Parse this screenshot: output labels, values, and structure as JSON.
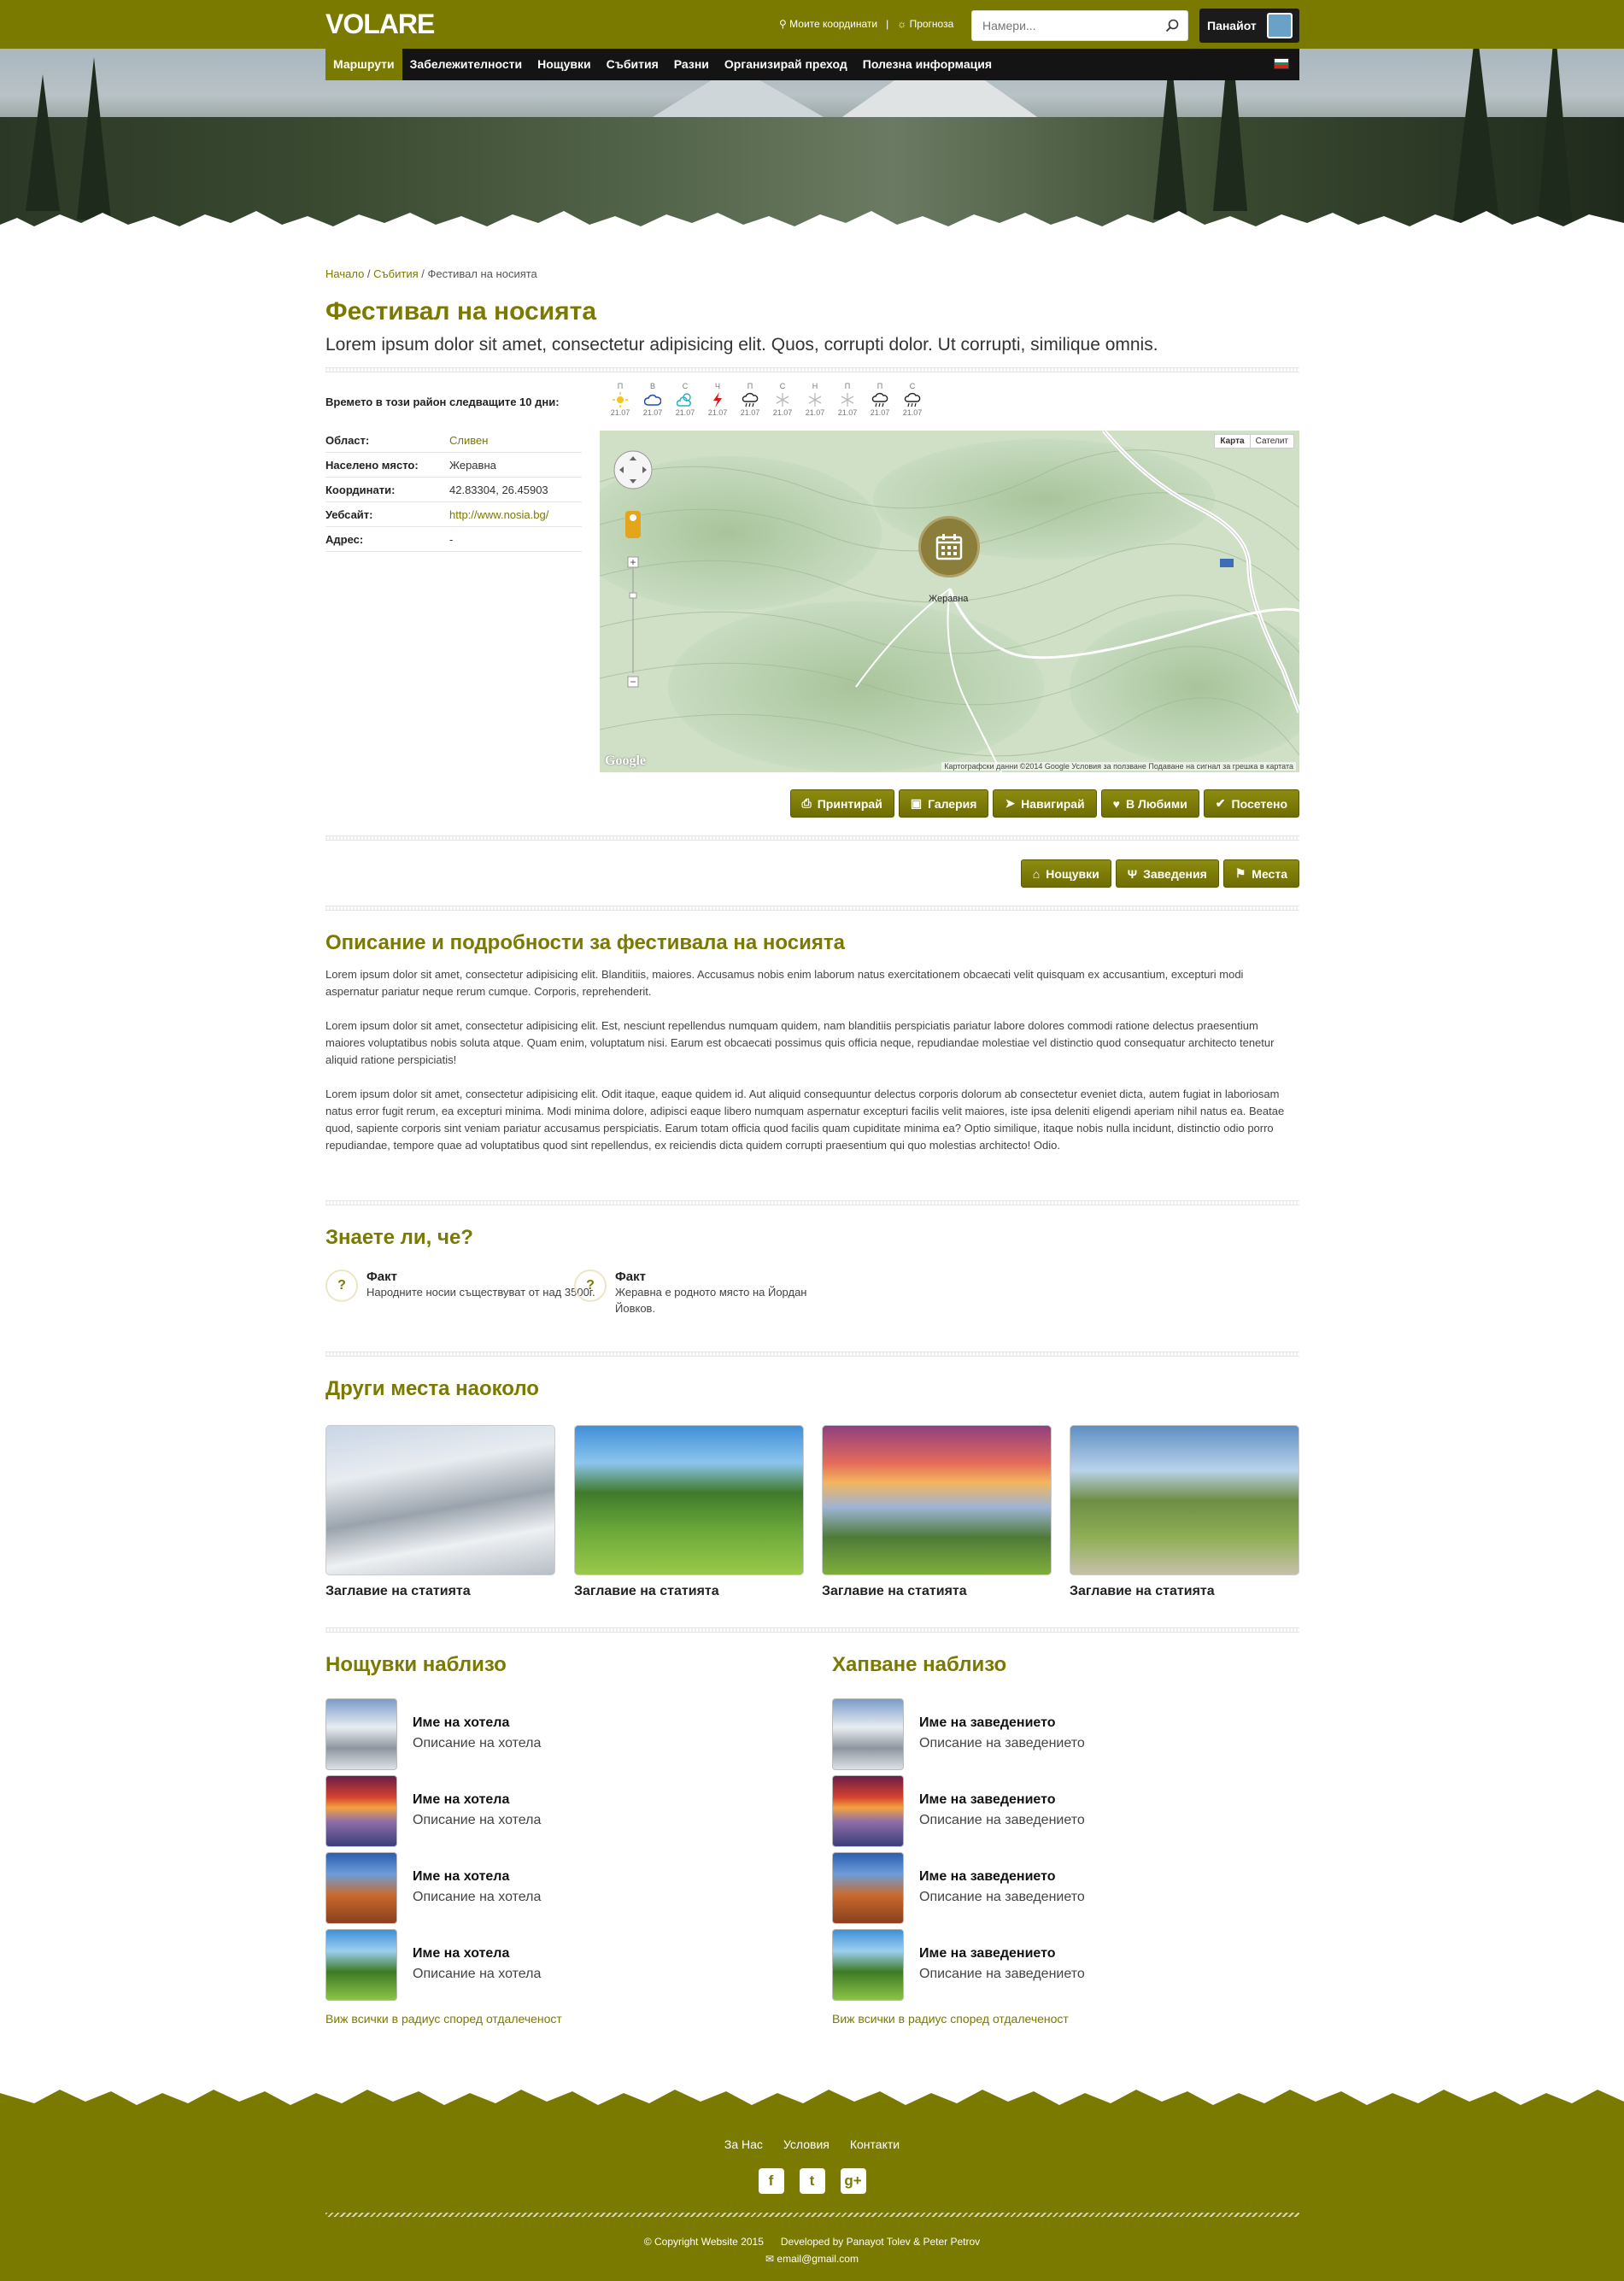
{
  "brand": "VOLARE",
  "topbar": {
    "coords": "Моите координати",
    "forecast": "Прогноза",
    "search_placeholder": "Намери...",
    "user": "Панайот"
  },
  "nav": [
    "Маршрути",
    "Забележителности",
    "Нощувки",
    "Събития",
    "Разни",
    "Организирай преход",
    "Полезна информация"
  ],
  "breadcrumb": {
    "home": "Начало",
    "section": "Събития",
    "current": "Фестивал на носията"
  },
  "title": "Фестивал на носията",
  "subtitle": "Lorem ipsum dolor sit amet, consectetur adipisicing elit. Quos, corrupti dolor. Ut corrupti, similique omnis.",
  "weather": {
    "label": "Времето в този район следващите 10 дни:",
    "days": [
      {
        "d": "П",
        "date": "21.07",
        "icon": "sun-icon"
      },
      {
        "d": "В",
        "date": "21.07",
        "icon": "cloud-icon"
      },
      {
        "d": "С",
        "date": "21.07",
        "icon": "cloud-sun-icon"
      },
      {
        "d": "Ч",
        "date": "21.07",
        "icon": "lightning-icon"
      },
      {
        "d": "П",
        "date": "21.07",
        "icon": "rain-icon"
      },
      {
        "d": "С",
        "date": "21.07",
        "icon": "snow-icon"
      },
      {
        "d": "Н",
        "date": "21.07",
        "icon": "snow-icon"
      },
      {
        "d": "П",
        "date": "21.07",
        "icon": "snow-icon"
      },
      {
        "d": "П",
        "date": "21.07",
        "icon": "rain-icon"
      },
      {
        "d": "С",
        "date": "21.07",
        "icon": "rain-icon"
      }
    ]
  },
  "info": [
    {
      "k": "Област:",
      "v": "Сливен"
    },
    {
      "k": "Населено място:",
      "v": "Жеравна"
    },
    {
      "k": "Координати:",
      "v": "42.83304, 26.45903"
    },
    {
      "k": "Уебсайт:",
      "v": "http://www.nosia.bg/"
    },
    {
      "k": "Адрес:",
      "v": "-"
    }
  ],
  "map": {
    "type_map": "Карта",
    "type_sat": "Сателит",
    "label": "Жеравна",
    "footer": "Картографски данни ©2014 Google   Условия за ползване   Подаване на сигнал за грешка в картата",
    "logo": "Google"
  },
  "actions": [
    "Принтирай",
    "Галерия",
    "Навигирай",
    "В Любими",
    "Посетено"
  ],
  "actions2": [
    "Нощувки",
    "Заведения",
    "Места"
  ],
  "description": {
    "title": "Описание и подробности за фестивала на носията",
    "paragraphs": [
      "Lorem ipsum dolor sit amet, consectetur adipisicing elit. Blanditiis, maiores. Accusamus nobis enim laborum natus exercitationem obcaecati velit quisquam ex accusantium, excepturi modi aspernatur pariatur neque rerum cumque. Corporis, reprehenderit.",
      "Lorem ipsum dolor sit amet, consectetur adipisicing elit. Est, nesciunt repellendus numquam quidem, nam blanditiis perspiciatis pariatur labore dolores commodi ratione delectus praesentium maiores voluptatibus nobis soluta atque. Quam enim, voluptatum nisi. Earum est obcaecati possimus quis officia neque, repudiandae molestiae vel distinctio quod consequatur architecto tenetur aliquid ratione perspiciatis!",
      "Lorem ipsum dolor sit amet, consectetur adipisicing elit. Odit itaque, eaque quidem id. Aut aliquid consequuntur delectus corporis dolorum ab consectetur eveniet dicta, autem fugiat in laboriosam natus error fugit rerum, ea excepturi minima. Modi minima dolore, adipisci eaque libero numquam aspernatur excepturi facilis velit maiores, iste ipsa deleniti eligendi aperiam nihil natus ea. Beatae quod, sapiente corporis sint veniam pariatur accusamus perspiciatis. Earum totam officia quod facilis quam cupiditate minima ea? Optio similique, itaque nobis nulla incidunt, distinctio odio porro repudiandae, tempore quae ad voluptatibus quod sint repellendus, ex reiciendis dicta quidem corrupti praesentium qui quo molestias architecto! Odio."
    ]
  },
  "facts": {
    "title": "Знаете ли, че?",
    "items": [
      {
        "t": "Факт",
        "d": "Народните носии съществуват от над 3500г."
      },
      {
        "t": "Факт",
        "d": "Жеравна е родното място на Йордан Йовков."
      }
    ]
  },
  "nearby": {
    "title": "Други места наоколо",
    "cards": [
      "Заглавие на статията",
      "Заглавие на статията",
      "Заглавие на статията",
      "Заглавие на статията"
    ]
  },
  "hotels": {
    "title": "Нощувки наблизо",
    "items": [
      {
        "t": "Име на хотела",
        "d": "Описание на хотела"
      },
      {
        "t": "Име на хотела",
        "d": "Описание на хотела"
      },
      {
        "t": "Име на хотела",
        "d": "Описание на хотела"
      },
      {
        "t": "Име на хотела",
        "d": "Описание на хотела"
      }
    ],
    "seeall": "Виж всички в радиус според отдалеченост"
  },
  "food": {
    "title": "Хапване наблизо",
    "items": [
      {
        "t": "Име на заведението",
        "d": "Описание на заведението"
      },
      {
        "t": "Име на заведението",
        "d": "Описание на заведението"
      },
      {
        "t": "Име на заведението",
        "d": "Описание на заведението"
      },
      {
        "t": "Име на заведението",
        "d": "Описание на заведението"
      }
    ],
    "seeall": "Виж всички в радиус според отдалеченост"
  },
  "footer": {
    "links": [
      "За Нас",
      "Условия",
      "Контакти"
    ],
    "copyright": "© Copyright Website 2015",
    "developed": "Developed by Panayot Tolev & Peter Petrov",
    "email": "email@gmail.com"
  },
  "colors": {
    "accent": "#7b7a00",
    "dark": "#141414"
  }
}
